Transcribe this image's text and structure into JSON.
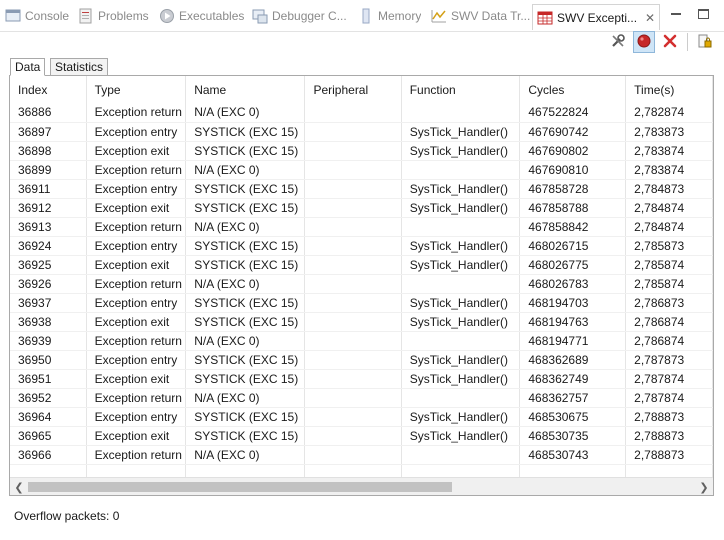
{
  "tabs": [
    {
      "label": "Console",
      "icon": "console-icon",
      "active": false
    },
    {
      "label": "Problems",
      "icon": "problems-icon",
      "active": false
    },
    {
      "label": "Executables",
      "icon": "executables-icon",
      "active": false
    },
    {
      "label": "Debugger C...",
      "icon": "debugger-console-icon",
      "active": false
    },
    {
      "label": "Memory",
      "icon": "memory-icon",
      "active": false
    },
    {
      "label": "SWV Data Tr...",
      "icon": "swv-data-trace-icon",
      "active": false
    },
    {
      "label": "SWV Excepti...",
      "icon": "swv-exception-icon",
      "active": true
    }
  ],
  "toolbar": {
    "buttons": [
      "configure-trace-icon",
      "record-icon",
      "clear-icon",
      "lock-icon"
    ]
  },
  "subtabs": [
    "Data",
    "Statistics"
  ],
  "table": {
    "columns": [
      "Index",
      "Type",
      "Name",
      "Peripheral",
      "Function",
      "Cycles",
      "Time(s)"
    ],
    "rows": [
      [
        "36886",
        "Exception return",
        "N/A (EXC 0)",
        "",
        "",
        "467522824",
        "2,782874"
      ],
      [
        "36897",
        "Exception entry",
        "SYSTICK (EXC 15)",
        "",
        "SysTick_Handler()",
        "467690742",
        "2,783873"
      ],
      [
        "36898",
        "Exception exit",
        "SYSTICK (EXC 15)",
        "",
        "SysTick_Handler()",
        "467690802",
        "2,783874"
      ],
      [
        "36899",
        "Exception return",
        "N/A (EXC 0)",
        "",
        "",
        "467690810",
        "2,783874"
      ],
      [
        "36911",
        "Exception entry",
        "SYSTICK (EXC 15)",
        "",
        "SysTick_Handler()",
        "467858728",
        "2,784873"
      ],
      [
        "36912",
        "Exception exit",
        "SYSTICK (EXC 15)",
        "",
        "SysTick_Handler()",
        "467858788",
        "2,784874"
      ],
      [
        "36913",
        "Exception return",
        "N/A (EXC 0)",
        "",
        "",
        "467858842",
        "2,784874"
      ],
      [
        "36924",
        "Exception entry",
        "SYSTICK (EXC 15)",
        "",
        "SysTick_Handler()",
        "468026715",
        "2,785873"
      ],
      [
        "36925",
        "Exception exit",
        "SYSTICK (EXC 15)",
        "",
        "SysTick_Handler()",
        "468026775",
        "2,785874"
      ],
      [
        "36926",
        "Exception return",
        "N/A (EXC 0)",
        "",
        "",
        "468026783",
        "2,785874"
      ],
      [
        "36937",
        "Exception entry",
        "SYSTICK (EXC 15)",
        "",
        "SysTick_Handler()",
        "468194703",
        "2,786873"
      ],
      [
        "36938",
        "Exception exit",
        "SYSTICK (EXC 15)",
        "",
        "SysTick_Handler()",
        "468194763",
        "2,786874"
      ],
      [
        "36939",
        "Exception return",
        "N/A (EXC 0)",
        "",
        "",
        "468194771",
        "2,786874"
      ],
      [
        "36950",
        "Exception entry",
        "SYSTICK (EXC 15)",
        "",
        "SysTick_Handler()",
        "468362689",
        "2,787873"
      ],
      [
        "36951",
        "Exception exit",
        "SYSTICK (EXC 15)",
        "",
        "SysTick_Handler()",
        "468362749",
        "2,787874"
      ],
      [
        "36952",
        "Exception return",
        "N/A (EXC 0)",
        "",
        "",
        "468362757",
        "2,787874"
      ],
      [
        "36964",
        "Exception entry",
        "SYSTICK (EXC 15)",
        "",
        "SysTick_Handler()",
        "468530675",
        "2,788873"
      ],
      [
        "36965",
        "Exception exit",
        "SYSTICK (EXC 15)",
        "",
        "SysTick_Handler()",
        "468530735",
        "2,788873"
      ],
      [
        "36966",
        "Exception return",
        "N/A (EXC 0)",
        "",
        "",
        "468530743",
        "2,788873"
      ]
    ]
  },
  "status": {
    "overflow_packets": "Overflow packets: 0"
  },
  "colors": {
    "accent": "#c62828",
    "pressed_bg": "#cfe5f7",
    "border": "#a9a9a9"
  }
}
